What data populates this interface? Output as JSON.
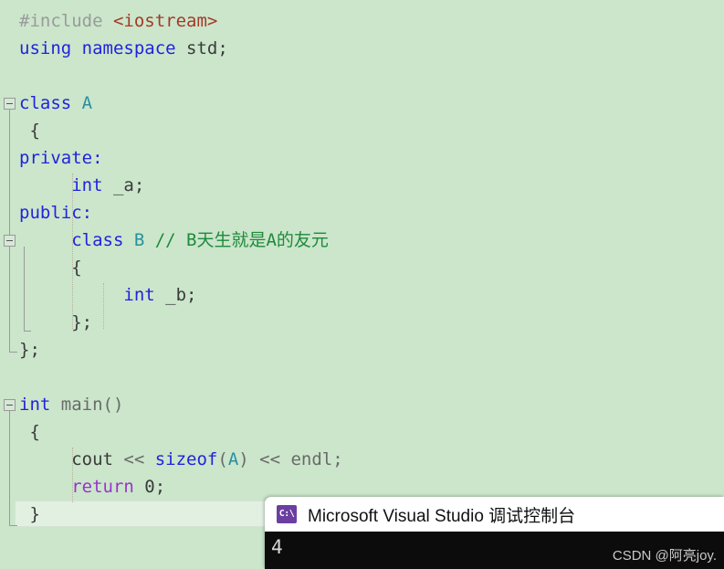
{
  "editor": {
    "background_color": "#cbe6cb",
    "current_line_color": "#e2f0e2",
    "lines": [
      {
        "indent": 0,
        "tokens": [
          {
            "t": "#include ",
            "c": "pre"
          },
          {
            "t": "<iostream>",
            "c": "string"
          }
        ]
      },
      {
        "indent": 0,
        "tokens": [
          {
            "t": "using namespace ",
            "c": "keyword"
          },
          {
            "t": "std;",
            "c": "plain"
          }
        ]
      },
      {
        "indent": 0,
        "tokens": []
      },
      {
        "indent": 0,
        "tokens": [
          {
            "t": "class ",
            "c": "keyword"
          },
          {
            "t": "A",
            "c": "type"
          }
        ]
      },
      {
        "indent": 0,
        "tokens": [
          {
            "t": " {",
            "c": "plain"
          }
        ]
      },
      {
        "indent": 0,
        "tokens": [
          {
            "t": "private:",
            "c": "keyword"
          }
        ]
      },
      {
        "indent": 0,
        "tokens": [
          {
            "t": "     int ",
            "c": "keyword"
          },
          {
            "t": "_a;",
            "c": "plain"
          }
        ]
      },
      {
        "indent": 0,
        "tokens": [
          {
            "t": "public:",
            "c": "keyword"
          }
        ]
      },
      {
        "indent": 0,
        "tokens": [
          {
            "t": "     class ",
            "c": "keyword"
          },
          {
            "t": "B ",
            "c": "type"
          },
          {
            "t": "// B天生就是A的友元",
            "c": "comment"
          }
        ]
      },
      {
        "indent": 0,
        "tokens": [
          {
            "t": "     {",
            "c": "plain"
          }
        ]
      },
      {
        "indent": 0,
        "tokens": [
          {
            "t": "          int ",
            "c": "keyword"
          },
          {
            "t": "_b;",
            "c": "plain"
          }
        ]
      },
      {
        "indent": 0,
        "tokens": [
          {
            "t": "     };",
            "c": "plain"
          }
        ]
      },
      {
        "indent": 0,
        "tokens": [
          {
            "t": "};",
            "c": "plain"
          }
        ]
      },
      {
        "indent": 0,
        "tokens": []
      },
      {
        "indent": 0,
        "tokens": [
          {
            "t": "int ",
            "c": "keyword"
          },
          {
            "t": "main",
            "c": "fn"
          },
          {
            "t": "()",
            "c": "op"
          }
        ]
      },
      {
        "indent": 0,
        "tokens": [
          {
            "t": " {",
            "c": "plain"
          }
        ]
      },
      {
        "indent": 0,
        "tokens": [
          {
            "t": "     cout ",
            "c": "plain"
          },
          {
            "t": "<< ",
            "c": "op"
          },
          {
            "t": "sizeof",
            "c": "keyword"
          },
          {
            "t": "(",
            "c": "op"
          },
          {
            "t": "A",
            "c": "type"
          },
          {
            "t": ") ",
            "c": "op"
          },
          {
            "t": "<< ",
            "c": "op"
          },
          {
            "t": "endl;",
            "c": "fn"
          }
        ]
      },
      {
        "indent": 0,
        "tokens": [
          {
            "t": "     return ",
            "c": "ctrl"
          },
          {
            "t": "0;",
            "c": "num"
          }
        ]
      },
      {
        "indent": 0,
        "tokens": [
          {
            "t": " }",
            "c": "plain"
          }
        ]
      }
    ]
  },
  "console": {
    "title": "Microsoft Visual Studio 调试控制台",
    "icon_label": "C:\\",
    "icon_name": "command-prompt-icon",
    "output": "4",
    "watermark": "CSDN @阿亮joy.",
    "title_bar_color": "#ffffff",
    "body_color": "#0c0c0c"
  }
}
